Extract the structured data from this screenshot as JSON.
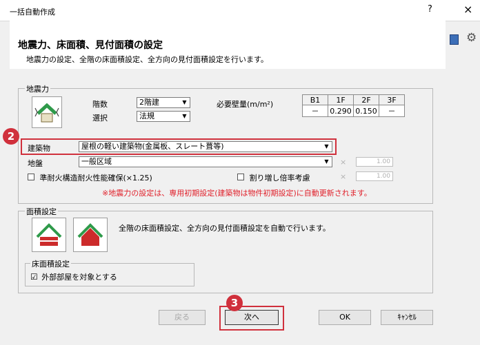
{
  "window": {
    "title": "一括自動作成",
    "help": "?",
    "close": "×"
  },
  "header": {
    "title": "地震力、床面積、見付面積の設定",
    "subtitle": "地震力の設定、全階の床面積設定、全方向の見付面積設定を行います。"
  },
  "seismic": {
    "group_label": "地震力",
    "floors_label": "階数",
    "floors_value": "2階建",
    "select_label": "選択",
    "select_value": "法規",
    "wall_label": "必要壁量(m/m²)",
    "table": {
      "headers": [
        "B1",
        "1F",
        "2F",
        "3F"
      ],
      "values": [
        "－",
        "0.290",
        "0.150",
        "－"
      ]
    },
    "building_label": "建築物",
    "building_value": "屋根の軽い建築物(金属板、スレート葺等)",
    "ground_label": "地盤",
    "ground_value": "一般区域",
    "multiplier_symbol": "×",
    "ground_factor": "1.00",
    "fireproof_label": "準耐火構造耐火性能確保(×1.25)",
    "increase_label": "割り増し倍率考慮",
    "increase_factor": "1.00",
    "note": "※地震力の設定は、専用初期設定(建築物は物件初期設定)に自動更新されます。"
  },
  "area": {
    "group_label": "面積設定",
    "description": "全階の床面積設定、全方向の見付面積設定を自動で行います。",
    "floor_group_label": "床面積設定",
    "outside_room_label": "外部部屋を対象とする",
    "outside_room_checked": "☑"
  },
  "buttons": {
    "back": "戻る",
    "next": "次へ",
    "ok": "OK",
    "cancel": "ｷｬﾝｾﾙ"
  },
  "steps": {
    "two": "2",
    "three": "3"
  },
  "colors": {
    "accent_red": "#d0303c",
    "roof_green": "#2f9a4a",
    "house_red": "#cc2b2b"
  }
}
